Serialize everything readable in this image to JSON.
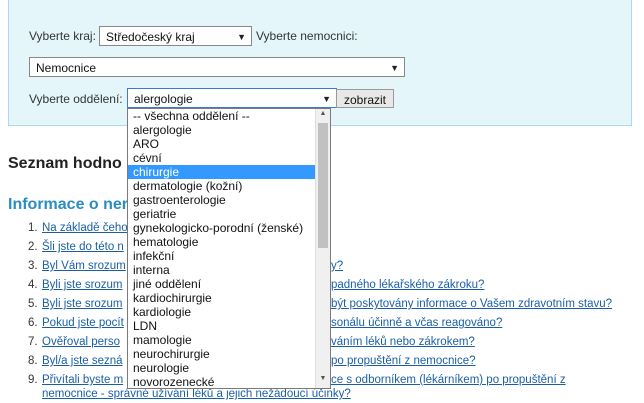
{
  "filters": {
    "region_label": "Vyberte kraj:",
    "region_value": "Středočeský kraj",
    "hospital_label": "Vyberte nemocnici:",
    "hospital_value": "Nemocnice",
    "department_label": "Vyberte oddělení:",
    "department_value": "alergologie",
    "submit_label": "zobrazit"
  },
  "dropdown": {
    "options": [
      "-- všechna oddělení --",
      "alergologie",
      "ARO",
      "cévní",
      "chirurgie",
      "dermatologie (kožní)",
      "gastroenterologie",
      "geriatrie",
      "gynekologicko-porodní (ženské)",
      "hematologie",
      "infekční",
      "interna",
      "jiné oddělení",
      "kardiochirurgie",
      "kardiologie",
      "LDN",
      "mamologie",
      "neurochirurgie",
      "neurologie",
      "novorozenecké"
    ],
    "highlighted_index": 4
  },
  "section_title": "Seznam hodno",
  "info_title": "Informace o ner",
  "questions": [
    {
      "num": "1.",
      "link": "Na základě čeho",
      "tail": ""
    },
    {
      "num": "2.",
      "link": "Šli jste do této n",
      "tail": ""
    },
    {
      "num": "3.",
      "link": "Byl Vám srozum",
      "tail": "y?"
    },
    {
      "num": "4.",
      "link": "Byli jste srozum",
      "tail": "padného lékařského zákroku?"
    },
    {
      "num": "5.",
      "link": "Byli jste srozum",
      "tail": "být poskytovány informace o Vašem zdravotním stavu?"
    },
    {
      "num": "6.",
      "link": "Pokud jste pocít",
      "tail": "sonálu účinně a včas reagováno?"
    },
    {
      "num": "7.",
      "link": "Ověřoval perso",
      "tail": "váním léků nebo zákrokem?"
    },
    {
      "num": "8.",
      "link": "Byl/a jste sezná",
      "tail": "po propuštění z nemocnice?"
    },
    {
      "num": "9.",
      "link": "Přivítali byste m",
      "tail": "ce s odborníkem (lékárníkem) po propuštění z"
    }
  ],
  "question9_line2": "nemocnice - správné užívání léků a jejich nežádoucí účinky?"
}
